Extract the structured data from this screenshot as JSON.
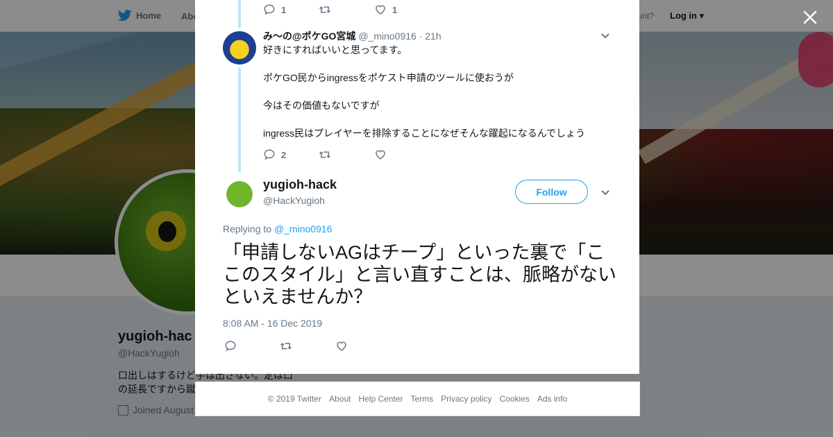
{
  "topbar": {
    "home_label": "Home",
    "about_label": "Abo",
    "account_text": "ccount?",
    "login_label": "Log in"
  },
  "profile": {
    "name": "yugioh-hac",
    "handle": "@HackYugioh",
    "bio": "口出しはするけど手は出さない。定は口の延長ですから蹴",
    "joined": "Joined August"
  },
  "background": {
    "add_info": "Ads info"
  },
  "modal": {
    "prev_tweet_actions": {
      "replies": "1",
      "retweets": "",
      "likes": "1"
    },
    "reply_tweet": {
      "author_name": "み〜の@ポケGO宮城",
      "author_handle": "@_mino0916",
      "time": "· 21h",
      "text": "好きにすればいいと思ってます。\n\nポケGO民からingressをポケスト申請のツールに使おうが\n\n今はその価値もないですが\n\ningress民はプレイヤーを排除することになぜそんな躍起になるんでしょう",
      "replies": "2",
      "retweets": "",
      "likes": ""
    },
    "main_tweet": {
      "author_name": "yugioh-hack",
      "author_handle": "@HackYugioh",
      "follow_label": "Follow",
      "replying_prefix": "Replying to",
      "replying_to": "@_mino0916",
      "text": "「申請しないAGはチープ」といった裏で「ここのスタイル」と言い直すことは、脈略がないといえませんか？",
      "timestamp": "8:08 AM - 16 Dec 2019"
    }
  },
  "footer": {
    "links": [
      "© 2019 Twitter",
      "About",
      "Help Center",
      "Terms",
      "Privacy policy",
      "Cookies",
      "Ads info"
    ]
  },
  "colors": {
    "accent": "#1da1f2",
    "thread_line": "#c4e4f7",
    "muted": "#657786"
  },
  "icons": [
    "twitter-bird-icon",
    "reply-icon",
    "retweet-icon",
    "like-icon",
    "chevron-down-icon",
    "close-icon",
    "calendar-icon"
  ]
}
